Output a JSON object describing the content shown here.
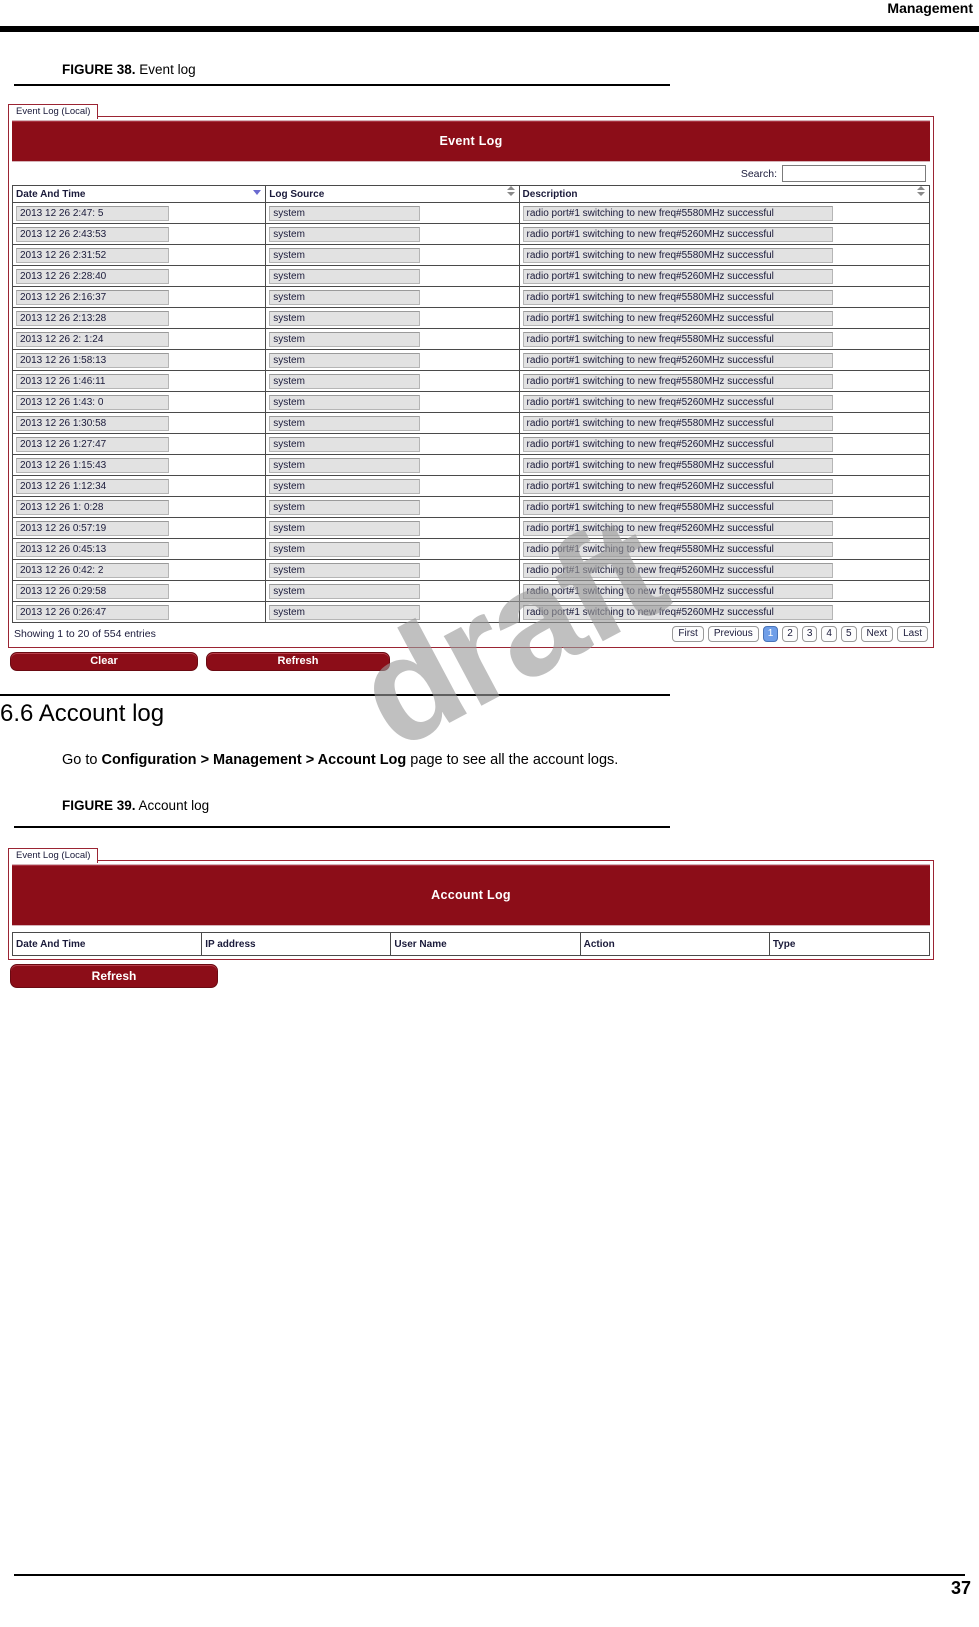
{
  "header": {
    "running_head": "Management"
  },
  "page_footer": {
    "page_number": "37"
  },
  "watermark": {
    "text": "draft"
  },
  "figure38": {
    "caption_label": "FIGURE 38.",
    "caption_text": "Event log"
  },
  "figure39": {
    "caption_label": "FIGURE 39.",
    "caption_text": "Account log"
  },
  "section": {
    "heading": "6.6 Account log",
    "body_prefix": "Go to ",
    "body_bold": "Configuration > Management > Account Log",
    "body_suffix": " page to see all the account logs."
  },
  "event_log_panel": {
    "tab_label": "Event Log (Local)",
    "title": "Event Log",
    "search_label": "Search:",
    "search_value": "",
    "search_placeholder": "",
    "columns": [
      "Date And Time",
      "Log Source",
      "Description"
    ],
    "sort_icons": [
      "sort-desc-icon",
      "sort-both-icon",
      "sort-both-icon"
    ],
    "rows": [
      {
        "date_time": "2013 12 26  2:47: 5",
        "log_source": "system",
        "description": "radio port#1 switching to new freq#5580MHz successful"
      },
      {
        "date_time": "2013 12 26  2:43:53",
        "log_source": "system",
        "description": "radio port#1 switching to new freq#5260MHz successful"
      },
      {
        "date_time": "2013 12 26  2:31:52",
        "log_source": "system",
        "description": "radio port#1 switching to new freq#5580MHz successful"
      },
      {
        "date_time": "2013 12 26  2:28:40",
        "log_source": "system",
        "description": "radio port#1 switching to new freq#5260MHz successful"
      },
      {
        "date_time": "2013 12 26  2:16:37",
        "log_source": "system",
        "description": "radio port#1 switching to new freq#5580MHz successful"
      },
      {
        "date_time": "2013 12 26  2:13:28",
        "log_source": "system",
        "description": "radio port#1 switching to new freq#5260MHz successful"
      },
      {
        "date_time": "2013 12 26  2: 1:24",
        "log_source": "system",
        "description": "radio port#1 switching to new freq#5580MHz successful"
      },
      {
        "date_time": "2013 12 26  1:58:13",
        "log_source": "system",
        "description": "radio port#1 switching to new freq#5260MHz successful"
      },
      {
        "date_time": "2013 12 26  1:46:11",
        "log_source": "system",
        "description": "radio port#1 switching to new freq#5580MHz successful"
      },
      {
        "date_time": "2013 12 26  1:43: 0",
        "log_source": "system",
        "description": "radio port#1 switching to new freq#5260MHz successful"
      },
      {
        "date_time": "2013 12 26  1:30:58",
        "log_source": "system",
        "description": "radio port#1 switching to new freq#5580MHz successful"
      },
      {
        "date_time": "2013 12 26  1:27:47",
        "log_source": "system",
        "description": "radio port#1 switching to new freq#5260MHz successful"
      },
      {
        "date_time": "2013 12 26  1:15:43",
        "log_source": "system",
        "description": "radio port#1 switching to new freq#5580MHz successful"
      },
      {
        "date_time": "2013 12 26  1:12:34",
        "log_source": "system",
        "description": "radio port#1 switching to new freq#5260MHz successful"
      },
      {
        "date_time": "2013 12 26  1: 0:28",
        "log_source": "system",
        "description": "radio port#1 switching to new freq#5580MHz successful"
      },
      {
        "date_time": "2013 12 26  0:57:19",
        "log_source": "system",
        "description": "radio port#1 switching to new freq#5260MHz successful"
      },
      {
        "date_time": "2013 12 26  0:45:13",
        "log_source": "system",
        "description": "radio port#1 switching to new freq#5580MHz successful"
      },
      {
        "date_time": "2013 12 26  0:42: 2",
        "log_source": "system",
        "description": "radio port#1 switching to new freq#5260MHz successful"
      },
      {
        "date_time": "2013 12 26  0:29:58",
        "log_source": "system",
        "description": "radio port#1 switching to new freq#5580MHz successful"
      },
      {
        "date_time": "2013 12 26  0:26:47",
        "log_source": "system",
        "description": "radio port#1 switching to new freq#5260MHz successful"
      }
    ],
    "showing_text": "Showing 1 to 20 of 554 entries",
    "pager": [
      {
        "label": "First",
        "active": false
      },
      {
        "label": "Previous",
        "active": false
      },
      {
        "label": "1",
        "active": true
      },
      {
        "label": "2",
        "active": false
      },
      {
        "label": "3",
        "active": false
      },
      {
        "label": "4",
        "active": false
      },
      {
        "label": "5",
        "active": false
      },
      {
        "label": "Next",
        "active": false
      },
      {
        "label": "Last",
        "active": false
      }
    ],
    "buttons": {
      "clear": "Clear",
      "refresh": "Refresh"
    }
  },
  "account_log_panel": {
    "tab_label": "Event Log (Local)",
    "title": "Account Log",
    "columns": [
      "Date And Time",
      "IP address",
      "User Name",
      "Action",
      "Type"
    ],
    "rows": [],
    "buttons": {
      "refresh": "Refresh"
    }
  },
  "colors": {
    "panel_accent": "#8c0d18",
    "pager_active": "#6f9ee8",
    "panel_border": "#9b2433"
  }
}
